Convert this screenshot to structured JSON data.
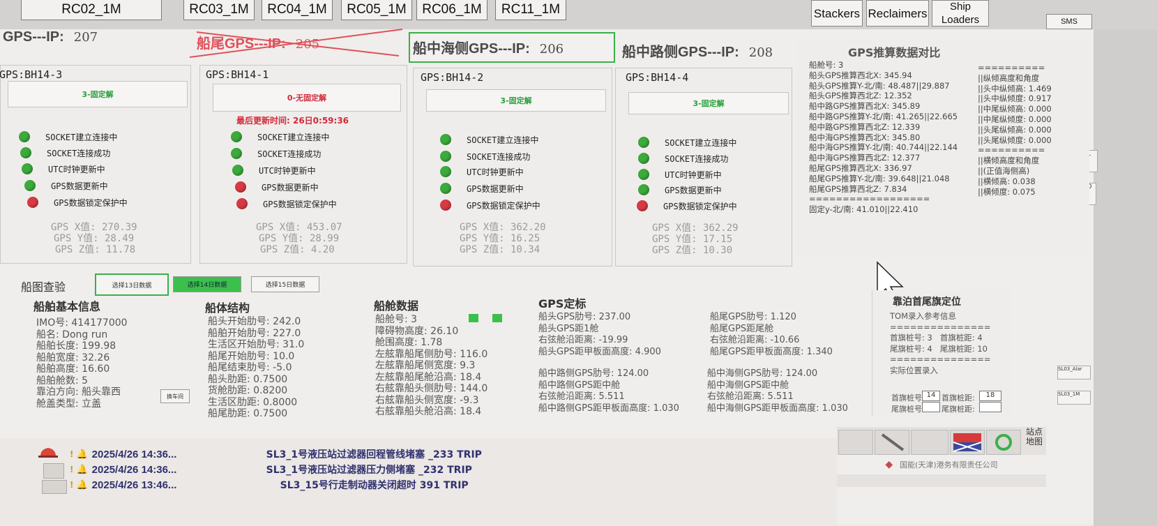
{
  "top_tabs": [
    {
      "label": "RC02_1M"
    },
    {
      "label": "RC03_1M"
    },
    {
      "label": "RC04_1M"
    },
    {
      "label": "RC05_1M"
    },
    {
      "label": "RC06_1M"
    },
    {
      "label": "RC11_1M"
    }
  ],
  "main_buttons": {
    "stackers": "Stackers",
    "reclaimers": "Reclaimers",
    "ship_loaders": "Ship Loaders",
    "sms": "SMS"
  },
  "ip_labels": [
    {
      "label": "GPS---IP:",
      "value": "207"
    },
    {
      "label": "船尾GPS---IP:",
      "value": "205"
    },
    {
      "label": "船中海侧GPS---IP:",
      "value": "206"
    },
    {
      "label": "船中路侧GPS---IP:",
      "value": "208"
    }
  ],
  "gps_units": [
    {
      "title": "GPS:BH14-3",
      "solution": "3-固定解",
      "solution_color": "#27a03a",
      "status": [
        [
          "SOCKET建立连接中",
          "green"
        ],
        [
          "SOCKET连接成功",
          "green"
        ],
        [
          "UTC时钟更新中",
          "green"
        ],
        [
          "GPS数据更新中",
          "green"
        ],
        [
          "GPS数据锁定保护中",
          "red"
        ]
      ],
      "x": "GPS X值: 270.39",
      "y": "GPS Y值: 28.49",
      "z": "GPS Z值: 11.78"
    },
    {
      "title": "GPS:BH14-1",
      "solution": "0-无固定解",
      "solution_color": "#d02a3a",
      "last_update": "最后更新时间: 26日0:59:36",
      "status": [
        [
          "SOCKET建立连接中",
          "green"
        ],
        [
          "SOCKET连接成功",
          "green"
        ],
        [
          "UTC时钟更新中",
          "green"
        ],
        [
          "GPS数据更新中",
          "red"
        ],
        [
          "GPS数据锁定保护中",
          "red"
        ]
      ],
      "x": "GPS X值: 453.07",
      "y": "GPS Y值: 28.99",
      "z": "GPS Z值: 4.20"
    },
    {
      "title": "GPS:BH14-2",
      "solution": "3-固定解",
      "solution_color": "#27a03a",
      "status": [
        [
          "SOCKET建立连接中",
          "green"
        ],
        [
          "SOCKET连接成功",
          "green"
        ],
        [
          "UTC时钟更新中",
          "green"
        ],
        [
          "GPS数据更新中",
          "green"
        ],
        [
          "GPS数据锁定保护中",
          "red"
        ]
      ],
      "x": "GPS X值: 362.20",
      "y": "GPS Y值: 16.25",
      "z": "GPS Z值: 10.34"
    },
    {
      "title": "GPS:BH14-4",
      "solution": "3-固定解",
      "solution_color": "#27a03a",
      "status": [
        [
          "SOCKET建立连接中",
          "green"
        ],
        [
          "SOCKET连接成功",
          "green"
        ],
        [
          "UTC时钟更新中",
          "green"
        ],
        [
          "GPS数据更新中",
          "green"
        ],
        [
          "GPS数据锁定保护中",
          "red"
        ]
      ],
      "x": "GPS X值: 362.29",
      "y": "GPS Y值: 17.15",
      "z": "GPS Z值: 10.30"
    }
  ],
  "compare": {
    "title": "GPS推算数据对比",
    "left_lines": [
      "船舱号: 3",
      "船头GPS推算西北X: 345.94",
      "船头GPS推算Y-北/南: 48.487||29.887",
      "船头GPS推算西北Z: 12.352",
      "船中路GPS推算西北X: 345.89",
      "船中路GPS推算Y-北/南: 41.265||22.665",
      "船中路GPS推算西北Z: 12.339",
      "船中海GPS推算西北X: 345.80",
      "船中海GPS推算Y-北/南: 40.744||22.144",
      "船中海GPS推算西北Z: 12.377",
      "船尾GPS推算西北X: 336.97",
      "船尾GPS推算Y-北/南: 39.648||21.048",
      "船尾GPS推算西北Z: 7.834",
      "==================",
      "固定y-北/南: 41.010||22.410"
    ],
    "right_lines": [
      "==========",
      "||纵倾高度和角度",
      "||头中纵倾高: 1.469",
      "||头中纵倾度: 0.917",
      "||中尾纵倾高: 0.000",
      "||中尾纵倾度: 0.000",
      "||头尾纵倾高: 0.000",
      "||头尾纵倾度: 0.000",
      "==========",
      "||横倾高度和角度",
      "||(正值海侧高)",
      "||横倾高: 0.038",
      "||横倾度: 0.075"
    ]
  },
  "ship_check": {
    "label": "船图查验",
    "btn13": "选择13日数据",
    "btn14": "选择14日数据",
    "btn15": "选择15日数据"
  },
  "ship_basic": {
    "title": "船舶基本信息",
    "lines": [
      "IMO号: 414177000",
      "船名: Dong run",
      "船舶长度: 199.98",
      "船舶宽度: 32.26",
      "船舶高度: 16.60",
      "船舶舱数: 5",
      "靠泊方向: 船头靠西",
      "舱盖类型: 立盖"
    ],
    "switch_btn": "换车间"
  },
  "hull": {
    "title": "船体结构",
    "lines": [
      "船头开始肋号: 242.0",
      "船舶开始肋号: 227.0",
      "生活区开始肋号: 31.0",
      "船尾开始肋号: 10.0",
      "船尾结束肋号: -5.0",
      "船头肋距: 0.7500",
      "货舱肋距: 0.8200",
      "生活区肋距: 0.8000",
      "船尾肋距: 0.7500"
    ]
  },
  "hold": {
    "title": "船舱数据",
    "lines": [
      "船舱号: 3",
      "障碍物高度: 26.10",
      "舱围高度: 1.78",
      "左舷靠船尾侧肋号: 116.0",
      "左舷靠船尾侧宽度: 9.3",
      "左舷靠船尾舱沿高: 18.4",
      "右舷靠船头侧肋号: 144.0",
      "右舷靠船头侧宽度: -9.3",
      "右舷靠船头舱沿高: 18.4"
    ]
  },
  "gps_mark": {
    "title": "GPS定标",
    "col1": [
      "船头GPS肋号: 237.00",
      "船头GPS距1舱",
      "右弦舱沿距离: -19.99",
      "船头GPS距甲板面高度: 4.900"
    ],
    "col2": [
      "船尾GPS肋号: 1.120",
      "船尾GPS距尾舱",
      "右弦舱沿距离: -10.66",
      "船尾GPS距甲板面高度: 1.340"
    ],
    "col3": [
      "船中路侧GPS肋号: 124.00",
      "船中路侧GPS距中舱",
      "右弦舱沿距离: 5.511",
      "船中路侧GPS距甲板面高度: 1.030"
    ],
    "col4": [
      "船中海侧GPS肋号: 124.00",
      "船中海侧GPS距中舱",
      "右弦舱沿距离: 5.511",
      "船中海侧GPS距甲板面高度: 1.030"
    ]
  },
  "berth": {
    "title": "靠泊首尾旗定位",
    "lines": [
      "TOM录入参考信息",
      "===============",
      "首旗桩号: 3   首旗桩距: 4",
      "尾旗桩号: 4   尾旗桩距: 10",
      "===============",
      "实际位置录入"
    ],
    "head_no": "首旗桩号:",
    "head_val1": "14",
    "head_dist": "首旗桩距:",
    "head_val2": "18",
    "tail_no": "尾旗桩号:",
    "tail_dist": "尾旗桩距:"
  },
  "alarms": [
    {
      "date": "2025/4/26 14:36...",
      "msg": "SL3_1号液压站过滤器回程管线堵塞 _233 TRIP"
    },
    {
      "date": "2025/4/26 14:36...",
      "msg": "SL3_1号液压站过滤器压力侧堵塞 _232 TRIP"
    },
    {
      "date": "2025/4/26 13:46...",
      "msg": "SL3_15号行走制动器关闭超时 391 TRIP"
    }
  ],
  "bottom_right": {
    "site_label": "站点\n地图",
    "company": "国能(天津)港务有限责任公司"
  },
  "right_strip": [
    "SL",
    "SL0",
    "SL03_Alar",
    "SL03_1M"
  ]
}
